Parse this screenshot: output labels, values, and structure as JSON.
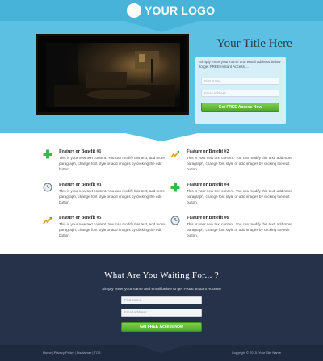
{
  "header": {
    "logo_text": "YOUR LOGO"
  },
  "hero": {
    "title": "Your Title Here",
    "optin": {
      "description": "Simply enter your name and email address below to get FREE Instant Access ...",
      "first_name_placeholder": "First Name",
      "email_placeholder": "Email Address",
      "button_label": "Get FREE Access Now"
    }
  },
  "features": [
    {
      "title": "Feature or Benefit #1",
      "icon": "green-plus-icon",
      "text": "This is your new text content. You can modify this text, add more paragraph, change font style or add images by clicking the edit button."
    },
    {
      "title": "Feature or Benefit #2",
      "icon": "chart-arrow-icon",
      "text": "This is your new text content. You can modify this text, add more paragraph, change font style or add images by clicking the edit button."
    },
    {
      "title": "Feature or Benefit #3",
      "icon": "clock-icon",
      "text": "This is your new text content. You can modify this text, add more paragraph, change font style or add images by clicking the edit button."
    },
    {
      "title": "Feature or Benefit #4",
      "icon": "green-plus-icon",
      "text": "This is your new text content. You can modify this text, add more paragraph, change font style or add images by clicking the edit button."
    },
    {
      "title": "Feature or Benefit #5",
      "icon": "chart-arrow-icon",
      "text": "This is your new text content. You can modify this text, add more paragraph, change font style or add images by clicking the edit button."
    },
    {
      "title": "Feature or Benefit #6",
      "icon": "clock-icon",
      "text": "This is your new text content. You can modify this text, add more paragraph, change font style or add images by clicking the edit button."
    }
  ],
  "cta": {
    "title": "What Are You Waiting For... ?",
    "subtitle": "Simply enter your name and email below to get FREE Instant Access!",
    "first_name_placeholder": "First Name",
    "email_placeholder": "Email Address",
    "button_label": "Get FREE Access Now"
  },
  "footer": {
    "links": [
      "Home",
      "Privacy Policy",
      "Disclaimer",
      "TOS"
    ],
    "copyright": "Copyright © 2015. Your Site Name"
  },
  "colors": {
    "hero_bg": "#5bc0e2",
    "cta_bg": "#263249",
    "button_green": "#4ca62b"
  }
}
